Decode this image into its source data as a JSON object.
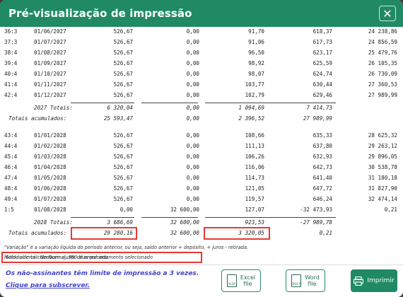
{
  "dialog": {
    "title": "Pré-visualização de impressão",
    "close": "✕"
  },
  "rows_2027": [
    [
      "36:3",
      "01/06/2027",
      "526,67",
      "0,00",
      "91,70",
      "618,37",
      "24 238,86"
    ],
    [
      "37:3",
      "01/07/2027",
      "526,67",
      "0,00",
      "91,06",
      "617,73",
      "24 856,59"
    ],
    [
      "38:4",
      "01/08/2027",
      "526,67",
      "0,00",
      "96,50",
      "623,17",
      "25 479,76"
    ],
    [
      "39:4",
      "01/09/2027",
      "526,67",
      "0,00",
      "98,92",
      "625,59",
      "26 105,35"
    ],
    [
      "40:4",
      "01/10/2027",
      "526,67",
      "0,00",
      "98,07",
      "624,74",
      "26 730,09"
    ],
    [
      "41:4",
      "01/11/2027",
      "526,67",
      "0,00",
      "103,77",
      "630,44",
      "27 360,53"
    ],
    [
      "42:4",
      "01/12/2027",
      "526,67",
      "0,00",
      "102,79",
      "629,46",
      "27 989,99"
    ]
  ],
  "totals_2027": {
    "label": "2027 Totais:",
    "c1": "6 320,04",
    "c2": "0,00",
    "c3": "1 094,69",
    "c4": "7 414,73"
  },
  "accum_2027": {
    "label": "Totais acumulados:",
    "c1": "25 593,47",
    "c2": "0,00",
    "c3": "2 396,52",
    "c4": "27 989,99"
  },
  "rows_2028": [
    [
      "43:4",
      "01/01/2028",
      "526,67",
      "0,00",
      "108,66",
      "635,33",
      "28 625,32"
    ],
    [
      "44:4",
      "01/02/2028",
      "526,67",
      "0,00",
      "111,13",
      "637,80",
      "29 263,12"
    ],
    [
      "45:4",
      "01/03/2028",
      "526,67",
      "0,00",
      "106,26",
      "632,93",
      "29 896,05"
    ],
    [
      "46:4",
      "01/04/2028",
      "526,67",
      "0,00",
      "116,06",
      "642,73",
      "30 538,78"
    ],
    [
      "47:4",
      "01/05/2028",
      "526,67",
      "0,00",
      "114,73",
      "641,40",
      "31 180,18"
    ],
    [
      "48:4",
      "01/06/2028",
      "526,67",
      "0,00",
      "121,05",
      "647,72",
      "31 827,90"
    ],
    [
      "49:4",
      "01/07/2028",
      "526,67",
      "0,00",
      "119,57",
      "646,24",
      "32 474,14"
    ],
    [
      "1:5",
      "01/08/2028",
      "0,00",
      "32 600,00",
      "127,07",
      "-32 473,93",
      "0,21"
    ]
  ],
  "totals_2028": {
    "label": "2028 Totais:",
    "c1": "3 686,69",
    "c2": "32 600,00",
    "c3": "923,53",
    "c4": "-27 989,78"
  },
  "accum_2028": {
    "label": "Totais acumulados:",
    "c1": "29 280,16",
    "c2": "32 600,00",
    "c3": "3 320,05",
    "c4": "0,21"
  },
  "notes": {
    "variation": "\"Variação\" é a variação líquida do período anterior, ou seja, saldo anterior + depósito, + juros - retirada.",
    "balance": "Saldo aberto - Nenhum ajuste de arredondamento selecionado",
    "method": "Método de cálculo:Normal, 360 dias por ano"
  },
  "footer": {
    "limit": "Os não-assinantes têm limite de impressão a 3 vezes.",
    "subscribe": "Clique para subscrever.",
    "excel_label": "Excel\nfile",
    "excel_icon": "XLSX",
    "word_label": "Word\nfile",
    "word_icon": "DOCX",
    "print_label": "Imprimir"
  },
  "colors": {
    "header": "#1f8a63",
    "highlight": "#e53935",
    "link": "#4444cc"
  }
}
